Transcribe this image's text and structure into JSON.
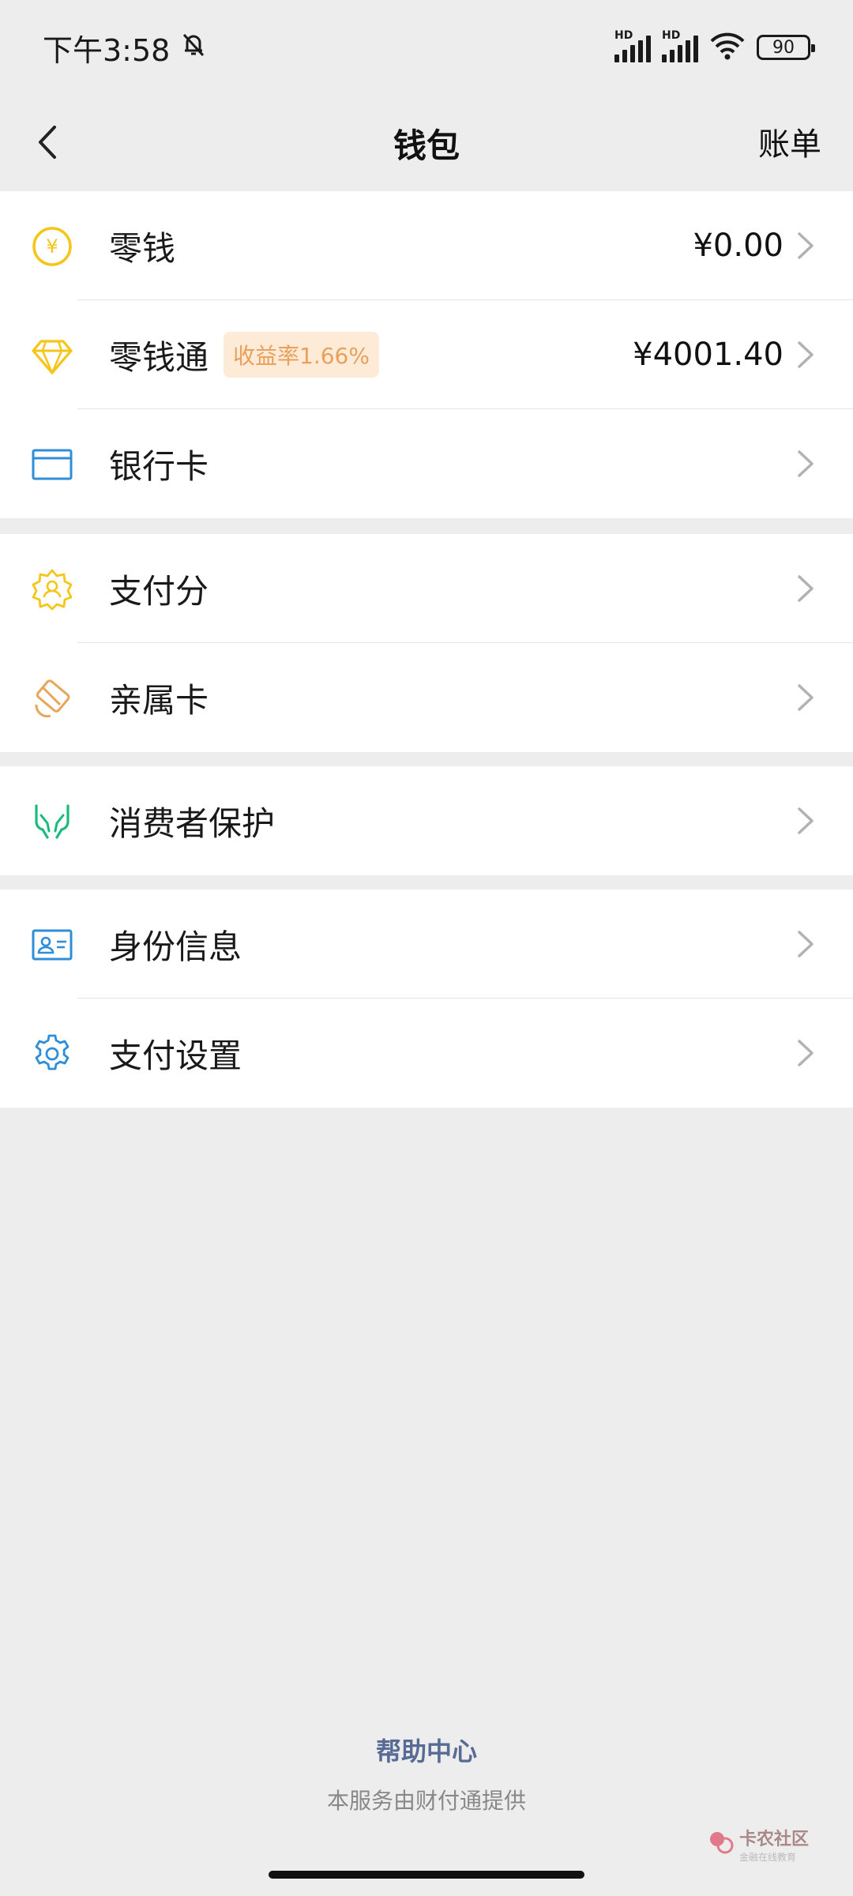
{
  "status_bar": {
    "time": "下午3:58",
    "signal_label_1": "HD",
    "signal_label_2": "HD",
    "battery": "90"
  },
  "nav": {
    "title": "钱包",
    "bill": "账单"
  },
  "groups": {
    "funds": {
      "change": {
        "label": "零钱",
        "value": "¥0.00"
      },
      "change_plus": {
        "label": "零钱通",
        "badge": "收益率1.66%",
        "value": "¥4001.40"
      },
      "bank_card": {
        "label": "银行卡"
      }
    },
    "credit": {
      "pay_score": {
        "label": "支付分"
      },
      "family_card": {
        "label": "亲属卡"
      }
    },
    "protection": {
      "consumer": {
        "label": "消费者保护"
      }
    },
    "settings": {
      "identity": {
        "label": "身份信息"
      },
      "pay_settings": {
        "label": "支付设置"
      }
    }
  },
  "footer": {
    "help": "帮助中心",
    "provider": "本服务由财付通提供",
    "watermark": "卡农社区",
    "watermark_sub": "金融在线教育"
  },
  "colors": {
    "yellow_icon": "#f5c518",
    "orange_icon": "#e8a65a",
    "blue_icon": "#2f8ed8",
    "green_icon": "#1bba7a",
    "badge_bg": "#fdebd8",
    "badge_text": "#e8a05a",
    "link": "#576b95"
  }
}
